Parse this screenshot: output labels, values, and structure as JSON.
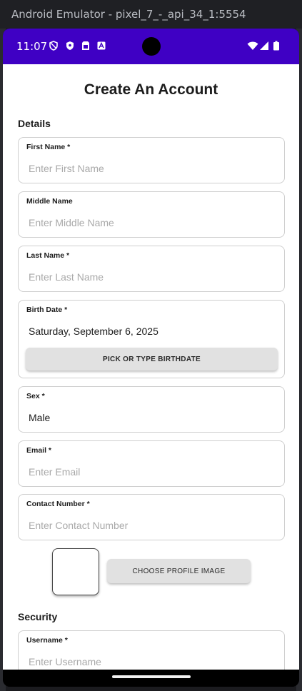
{
  "emulator": {
    "title": "Android Emulator - pixel_7_-_api_34_1:5554"
  },
  "status_bar": {
    "time": "11:07",
    "icons_left": [
      "shield-outline-icon",
      "shield-filled-icon",
      "sim-card-icon",
      "assistant-icon"
    ],
    "icons_right": [
      "wifi-icon",
      "signal-icon",
      "battery-icon"
    ],
    "color": "#3f00c4"
  },
  "page": {
    "title": "Create An Account",
    "sections": {
      "details": "Details",
      "security": "Security"
    },
    "fields": {
      "first_name": {
        "label": "First Name *",
        "placeholder": "Enter First Name"
      },
      "middle_name": {
        "label": "Middle Name",
        "placeholder": "Enter Middle Name"
      },
      "last_name": {
        "label": "Last Name *",
        "placeholder": "Enter Last Name"
      },
      "birth_date": {
        "label": "Birth Date *",
        "value": "Saturday, September 6, 2025",
        "button": "PICK OR TYPE BIRTHDATE"
      },
      "sex": {
        "label": "Sex *",
        "value": "Male"
      },
      "email": {
        "label": "Email *",
        "placeholder": "Enter Email"
      },
      "contact_number": {
        "label": "Contact Number *",
        "placeholder": "Enter Contact Number"
      },
      "username": {
        "label": "Username *",
        "placeholder": "Enter Username"
      }
    },
    "profile_image_button": "CHOOSE PROFILE IMAGE"
  }
}
